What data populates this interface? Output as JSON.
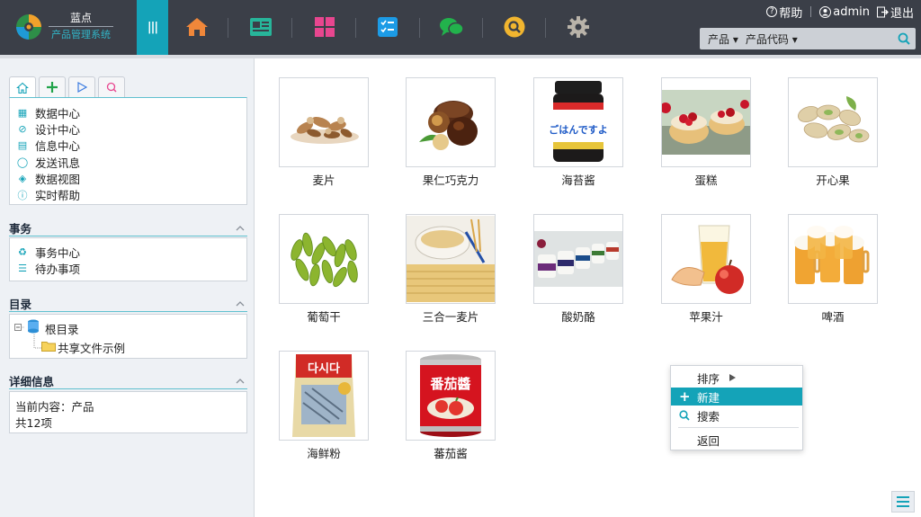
{
  "header": {
    "brand_title": "蓝点",
    "brand_subtitle": "产品管理系统",
    "menu_glyph": "|||",
    "nav_icons": [
      "home-icon",
      "news-icon",
      "apps-icon",
      "tasks-icon",
      "chat-icon",
      "search-icon",
      "gear-icon"
    ],
    "help_label": "帮助",
    "user_label": "admin",
    "logout_label": "退出",
    "search": {
      "category_selected": "产品",
      "field_selected": "产品代码",
      "value": "",
      "placeholder": ""
    },
    "colors": {
      "bar": "#3b3f48",
      "accent": "#14a3b8"
    }
  },
  "sidebar": {
    "tabs": [
      "home-icon",
      "plus-icon",
      "play-icon",
      "search-icon"
    ],
    "nav_items": [
      {
        "label": "数据中心",
        "icon": "grid-icon"
      },
      {
        "label": "设计中心",
        "icon": "design-icon"
      },
      {
        "label": "信息中心",
        "icon": "doc-icon"
      },
      {
        "label": "发送讯息",
        "icon": "message-icon"
      },
      {
        "label": "数据视图",
        "icon": "layers-icon"
      },
      {
        "label": "实时帮助",
        "icon": "help-icon"
      }
    ],
    "affairs": {
      "title": "事务",
      "items": [
        {
          "label": "事务中心",
          "icon": "recycle-icon"
        },
        {
          "label": "待办事项",
          "icon": "list-icon"
        }
      ]
    },
    "directory": {
      "title": "目录",
      "root": "根目录",
      "child": "共享文件示例"
    },
    "details": {
      "title": "详细信息",
      "current": "当前内容：产品",
      "count": "共12项"
    }
  },
  "products": [
    {
      "name": "麦片"
    },
    {
      "name": "果仁巧克力"
    },
    {
      "name": "海苔酱",
      "label": "ごはんですよ"
    },
    {
      "name": "蛋糕"
    },
    {
      "name": "开心果"
    },
    {
      "name": "葡萄干"
    },
    {
      "name": "三合一麦片"
    },
    {
      "name": "酸奶酪"
    },
    {
      "name": "苹果汁"
    },
    {
      "name": "啤酒"
    },
    {
      "name": "海鲜粉",
      "label": "다시다"
    },
    {
      "name": "蕃茄酱",
      "label": "番茄醬"
    }
  ],
  "context_menu": {
    "sort": "排序",
    "new": "新建",
    "search": "搜索",
    "back": "返回"
  }
}
